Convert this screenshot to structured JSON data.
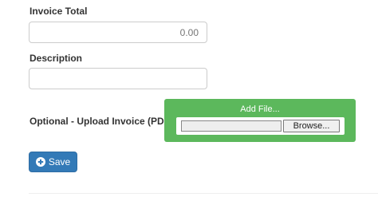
{
  "form": {
    "invoice_total_label": "Invoice Total",
    "invoice_total_placeholder": "0.00",
    "description_label": "Description",
    "description_value": "",
    "upload_label": "Optional - Upload Invoice (PDF)",
    "add_file_title": "Add File...",
    "browse_label": "Browse...",
    "save_label": "Save"
  },
  "colors": {
    "upload_box": "#5cb85c",
    "save_button": "#337ab7"
  },
  "icons": {
    "save": "plus-circle-icon"
  }
}
